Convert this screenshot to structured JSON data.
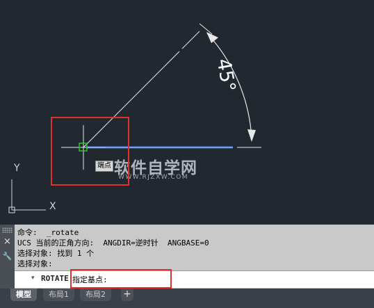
{
  "canvas": {
    "angle_label": "45°",
    "tooltip": "端点",
    "ucs_y": "Y",
    "ucs_x": "X"
  },
  "watermark": {
    "main": "软件自学网",
    "sub": "WWW.RJZXW.COM"
  },
  "command": {
    "history": [
      "命令:  _rotate",
      "UCS 当前的正角方向:  ANGDIR=逆时针  ANGBASE=0",
      "选择对象: 找到 1 个",
      "选择对象:"
    ],
    "arrow": "▾",
    "prefix": "ROTATE",
    "prompt": "指定基点:",
    "input_value": ""
  },
  "toolstrip": {
    "close_icon": "×",
    "customize_icon": "🔧"
  },
  "tabs": [
    {
      "label": "模型",
      "active": true
    },
    {
      "label": "布局1",
      "active": false
    },
    {
      "label": "布局2",
      "active": false
    }
  ],
  "tab_add": "+",
  "colors": {
    "canvas_bg": "#212830",
    "highlight_line": "#3b6fe0",
    "annotation_red": "#e03030",
    "snap_marker": "#22cc22"
  }
}
